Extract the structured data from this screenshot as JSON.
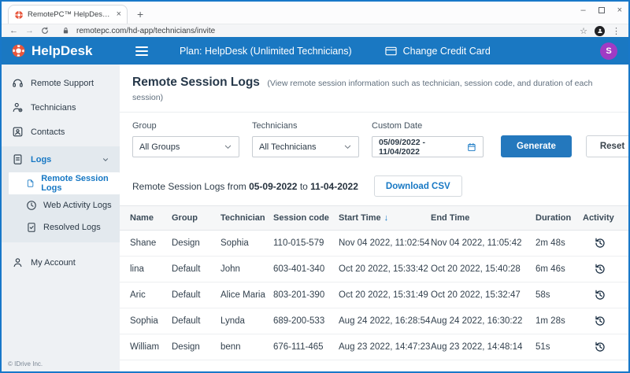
{
  "browser": {
    "tab_title": "RemotePC™ HelpDesk - Remote",
    "url": "remotepc.com/hd-app/technicians/invite",
    "icons": {
      "close_tab": "×",
      "new_tab": "+",
      "minimize": "–",
      "close_window": "×",
      "back": "←",
      "forward": "→",
      "star": "☆",
      "menu": "⋮"
    }
  },
  "header": {
    "brand": "HelpDesk",
    "plan_label": "Plan: HelpDesk (Unlimited Technicians)",
    "change_credit_card": "Change Credit Card",
    "avatar_initial": "S",
    "colors": {
      "header_bg": "#1a78c2",
      "avatar_bg": "#a03bc4",
      "logo_orange": "#e8563c",
      "accent_blue": "#1778c4"
    }
  },
  "sidebar": {
    "items": [
      {
        "label": "Remote Support",
        "icon": "headset-icon"
      },
      {
        "label": "Technicians",
        "icon": "technician-icon"
      },
      {
        "label": "Contacts",
        "icon": "contacts-icon"
      },
      {
        "label": "Logs",
        "icon": "logs-icon",
        "expanded": true,
        "children": [
          {
            "label": "Remote Session Logs",
            "icon": "session-log-icon",
            "selected": true
          },
          {
            "label": "Web Activity Logs",
            "icon": "clock-icon",
            "selected": false
          },
          {
            "label": "Resolved Logs",
            "icon": "resolved-log-icon",
            "selected": false
          }
        ]
      },
      {
        "label": "My Account",
        "icon": "account-icon"
      }
    ],
    "footer": "© IDrive Inc."
  },
  "main": {
    "title": "Remote Session Logs",
    "subtitle": "(View remote session information such as technician, session code, and duration of each session)",
    "filters": {
      "group_label": "Group",
      "group_value": "All Groups",
      "technicians_label": "Technicians",
      "technicians_value": "All Technicians",
      "custom_date_label": "Custom Date",
      "custom_date_value": "05/09/2022 - 11/04/2022",
      "generate_label": "Generate",
      "reset_label": "Reset"
    },
    "summary": {
      "prefix": "Remote Session Logs from",
      "from_date": "05-09-2022",
      "middle": "to",
      "to_date": "11-04-2022",
      "download_csv": "Download CSV"
    },
    "table": {
      "columns": [
        "Name",
        "Group",
        "Technician",
        "Session code",
        "Start Time",
        "End Time",
        "Duration",
        "Activity"
      ],
      "sorted_column": "Start Time",
      "sort_direction": "desc",
      "sort_icon": "↓",
      "rows": [
        {
          "name": "Shane",
          "group": "Design",
          "technician": "Sophia",
          "session_code": "110-015-579",
          "start_time": "Nov 04 2022, 11:02:54",
          "end_time": "Nov 04 2022, 11:05:42",
          "duration": "2m 48s"
        },
        {
          "name": "lina",
          "group": "Default",
          "technician": "John",
          "session_code": "603-401-340",
          "start_time": "Oct 20 2022, 15:33:42",
          "end_time": "Oct 20 2022, 15:40:28",
          "duration": "6m 46s"
        },
        {
          "name": "Aric",
          "group": "Default",
          "technician": "Alice Maria",
          "session_code": "803-201-390",
          "start_time": "Oct 20 2022, 15:31:49",
          "end_time": "Oct 20 2022, 15:32:47",
          "duration": "58s"
        },
        {
          "name": "Sophia",
          "group": "Default",
          "technician": "Lynda",
          "session_code": "689-200-533",
          "start_time": "Aug 24 2022, 16:28:54",
          "end_time": "Aug 24 2022, 16:30:22",
          "duration": "1m 28s"
        },
        {
          "name": "William",
          "group": "Design",
          "technician": "benn",
          "session_code": "676-111-465",
          "start_time": "Aug 23 2022, 14:47:23",
          "end_time": "Aug 23 2022, 14:48:14",
          "duration": "51s"
        }
      ]
    }
  }
}
